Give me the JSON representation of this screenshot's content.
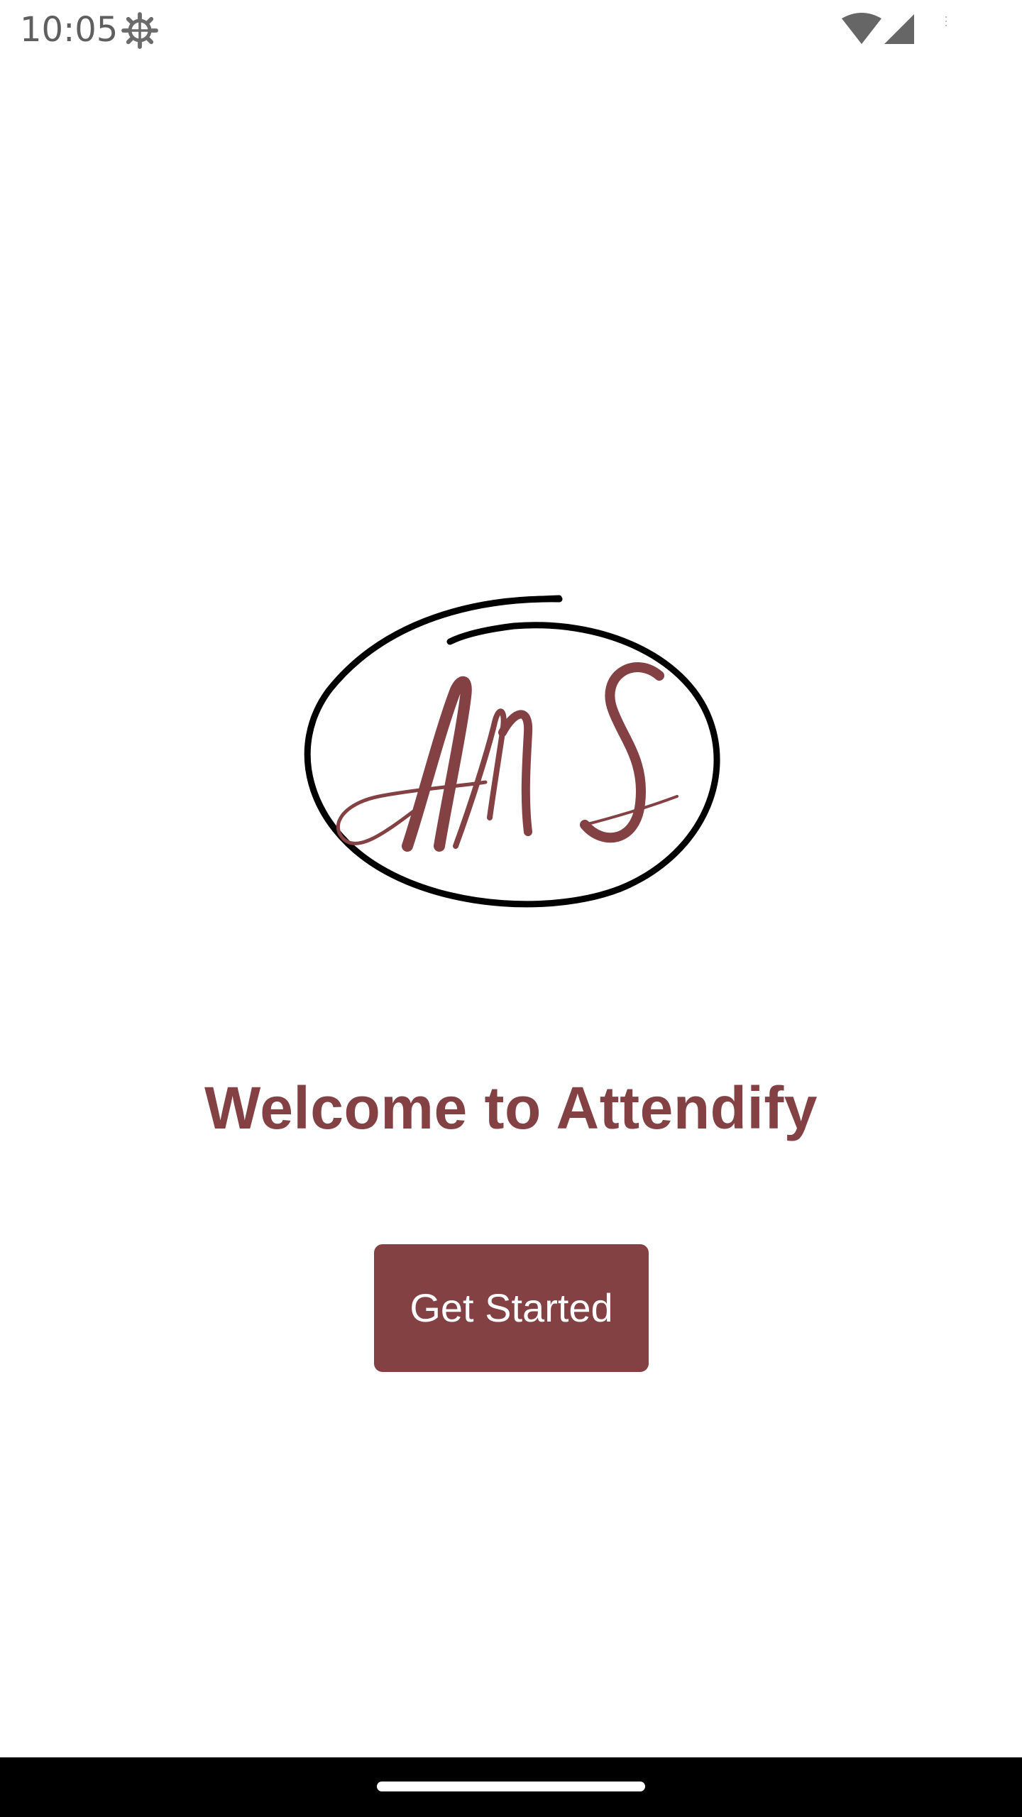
{
  "status_bar": {
    "time": "10:05",
    "icons": [
      "gear-icon",
      "wifi-icon",
      "signal-icon"
    ]
  },
  "logo": {
    "text": "AMS",
    "icon": "ams-logo"
  },
  "welcome": {
    "title": "Welcome to Attendify"
  },
  "actions": {
    "get_started_label": "Get Started"
  },
  "colors": {
    "accent": "#844144",
    "background": "#ffffff",
    "nav_bar": "#000000"
  }
}
